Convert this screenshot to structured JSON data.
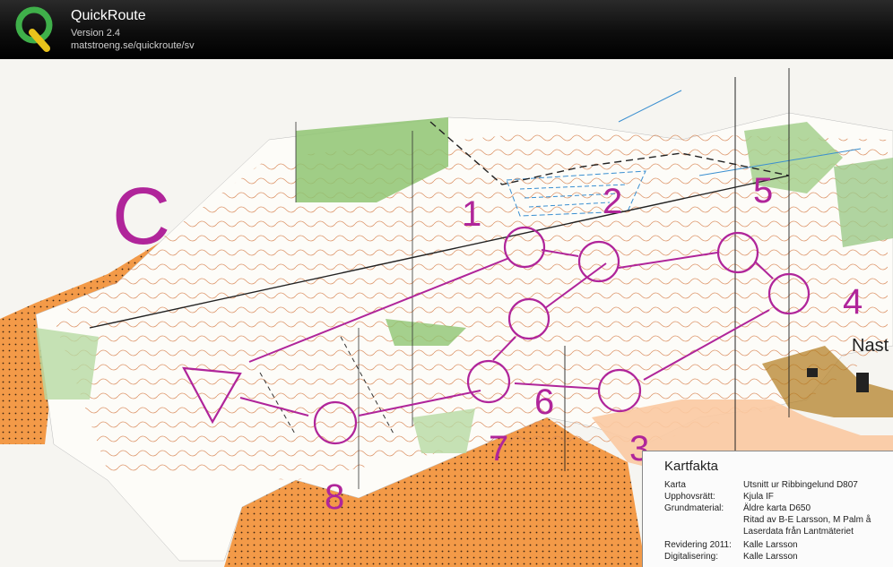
{
  "app": {
    "name": "QuickRoute",
    "version": "Version 2.4",
    "url": "matstroeng.se/quickroute/sv",
    "logo_letter": "Q"
  },
  "map": {
    "course_letter": "C",
    "place_label": "Nast",
    "controls": [
      "1",
      "2",
      "3",
      "4",
      "5",
      "6",
      "7",
      "8"
    ],
    "colors": {
      "course": "#b0259a",
      "forest_open": "#f08a3a",
      "contour": "#c8602a",
      "water": "#3a8fd0",
      "green": "#9cc98a"
    }
  },
  "kartfakta": {
    "title": "Kartfakta",
    "rows": [
      {
        "label": "Karta",
        "value": "Utsnitt ur Ribbingelund  D807"
      },
      {
        "label": "Upphovsrätt:",
        "value": "Kjula IF"
      },
      {
        "label": "Grundmaterial:",
        "value": "Äldre karta D650"
      },
      {
        "label": "",
        "value": "Ritad av B-E Larsson, M Palm å"
      },
      {
        "label": "",
        "value": "Laserdata från Lantmäteriet"
      },
      {
        "label": "Revidering 2011:",
        "value": "Kalle Larsson"
      },
      {
        "label": "Digitalisering:",
        "value": "Kalle Larsson"
      }
    ]
  }
}
